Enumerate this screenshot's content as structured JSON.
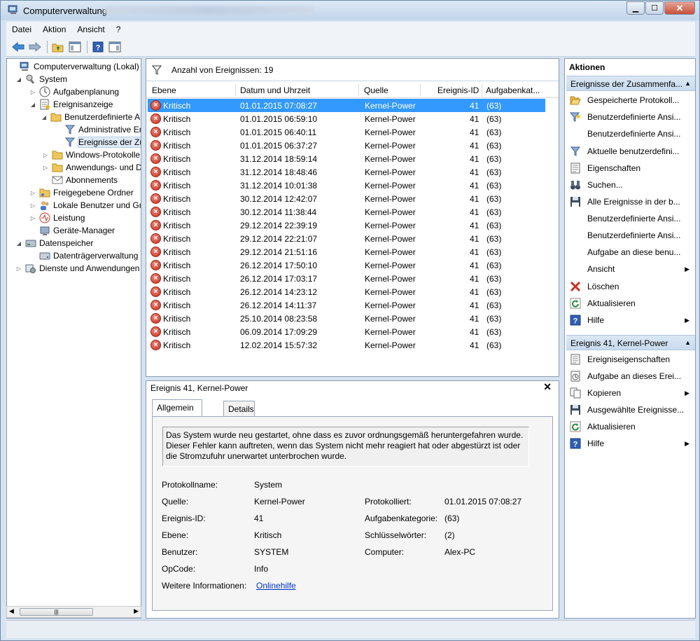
{
  "window": {
    "title": "Computerverwaltung",
    "buttons": {
      "minimize": "▁",
      "maximize": "☐",
      "close": "✕"
    }
  },
  "menu": {
    "items": [
      "Datei",
      "Aktion",
      "Ansicht",
      "?"
    ]
  },
  "toolbar": {
    "icons": [
      "back-arrow-icon",
      "forward-arrow-icon",
      "folder-up-icon",
      "show-hide-tree-icon",
      "help-icon",
      "show-hide-action-icon"
    ]
  },
  "tree": {
    "items": [
      {
        "label": "Computerverwaltung (Lokal)",
        "icon": "computer-management-icon",
        "expander": ""
      },
      {
        "label": "System",
        "icon": "system-tools-icon",
        "expander": "◢"
      },
      {
        "label": "Aufgabenplanung",
        "icon": "clock-icon",
        "expander": "▷"
      },
      {
        "label": "Ereignisanzeige",
        "icon": "event-viewer-icon",
        "expander": "◢"
      },
      {
        "label": "Benutzerdefinierte Ansichten",
        "icon": "folder-icon",
        "expander": "◢"
      },
      {
        "label": "Administrative Ereignisse",
        "icon": "filter-icon",
        "expander": ""
      },
      {
        "label": "Ereignisse der Zusammenfassungsseite",
        "icon": "filter-icon",
        "expander": ""
      },
      {
        "label": "Windows-Protokolle",
        "icon": "folder-icon",
        "expander": "▷"
      },
      {
        "label": "Anwendungs- und Dienstprotokolle",
        "icon": "folder-icon",
        "expander": "▷"
      },
      {
        "label": "Abonnements",
        "icon": "subscriptions-icon",
        "expander": ""
      },
      {
        "label": "Freigegebene Ordner",
        "icon": "shared-folder-icon",
        "expander": "▷"
      },
      {
        "label": "Lokale Benutzer und Gruppen",
        "icon": "users-icon",
        "expander": "▷"
      },
      {
        "label": "Leistung",
        "icon": "performance-icon",
        "expander": "▷"
      },
      {
        "label": "Geräte-Manager",
        "icon": "device-manager-icon",
        "expander": ""
      },
      {
        "label": "Datenspeicher",
        "icon": "storage-icon",
        "expander": "◢"
      },
      {
        "label": "Datenträgerverwaltung",
        "icon": "disk-icon",
        "expander": ""
      },
      {
        "label": "Dienste und Anwendungen",
        "icon": "services-icon",
        "expander": "▷"
      }
    ]
  },
  "events": {
    "filter_label": "Anzahl von Ereignissen: 19",
    "columns": [
      "Ebene",
      "Datum und Uhrzeit",
      "Quelle",
      "Ereignis-ID",
      "Aufgabenkat..."
    ],
    "rows": [
      {
        "level": "Kritisch",
        "date": "01.01.2015 07:08:27",
        "source": "Kernel-Power",
        "id": "41",
        "cat": "(63)"
      },
      {
        "level": "Kritisch",
        "date": "01.01.2015 06:59:10",
        "source": "Kernel-Power",
        "id": "41",
        "cat": "(63)"
      },
      {
        "level": "Kritisch",
        "date": "01.01.2015 06:40:11",
        "source": "Kernel-Power",
        "id": "41",
        "cat": "(63)"
      },
      {
        "level": "Kritisch",
        "date": "01.01.2015 06:37:27",
        "source": "Kernel-Power",
        "id": "41",
        "cat": "(63)"
      },
      {
        "level": "Kritisch",
        "date": "31.12.2014 18:59:14",
        "source": "Kernel-Power",
        "id": "41",
        "cat": "(63)"
      },
      {
        "level": "Kritisch",
        "date": "31.12.2014 18:48:46",
        "source": "Kernel-Power",
        "id": "41",
        "cat": "(63)"
      },
      {
        "level": "Kritisch",
        "date": "31.12.2014 10:01:38",
        "source": "Kernel-Power",
        "id": "41",
        "cat": "(63)"
      },
      {
        "level": "Kritisch",
        "date": "30.12.2014 12:42:07",
        "source": "Kernel-Power",
        "id": "41",
        "cat": "(63)"
      },
      {
        "level": "Kritisch",
        "date": "30.12.2014 11:38:44",
        "source": "Kernel-Power",
        "id": "41",
        "cat": "(63)"
      },
      {
        "level": "Kritisch",
        "date": "29.12.2014 22:39:19",
        "source": "Kernel-Power",
        "id": "41",
        "cat": "(63)"
      },
      {
        "level": "Kritisch",
        "date": "29.12.2014 22:21:07",
        "source": "Kernel-Power",
        "id": "41",
        "cat": "(63)"
      },
      {
        "level": "Kritisch",
        "date": "29.12.2014 21:51:16",
        "source": "Kernel-Power",
        "id": "41",
        "cat": "(63)"
      },
      {
        "level": "Kritisch",
        "date": "26.12.2014 17:50:10",
        "source": "Kernel-Power",
        "id": "41",
        "cat": "(63)"
      },
      {
        "level": "Kritisch",
        "date": "26.12.2014 17:03:17",
        "source": "Kernel-Power",
        "id": "41",
        "cat": "(63)"
      },
      {
        "level": "Kritisch",
        "date": "26.12.2014 14:23:12",
        "source": "Kernel-Power",
        "id": "41",
        "cat": "(63)"
      },
      {
        "level": "Kritisch",
        "date": "26.12.2014 14:11:37",
        "source": "Kernel-Power",
        "id": "41",
        "cat": "(63)"
      },
      {
        "level": "Kritisch",
        "date": "25.10.2014 08:23:58",
        "source": "Kernel-Power",
        "id": "41",
        "cat": "(63)"
      },
      {
        "level": "Kritisch",
        "date": "06.09.2014 17:09:29",
        "source": "Kernel-Power",
        "id": "41",
        "cat": "(63)"
      },
      {
        "level": "Kritisch",
        "date": "12.02.2014 15:57:32",
        "source": "Kernel-Power",
        "id": "41",
        "cat": "(63)"
      }
    ]
  },
  "detail": {
    "title": "Ereignis 41, Kernel-Power",
    "close": "✕",
    "tabs": [
      "Allgemein",
      "Details"
    ],
    "description": "Das System wurde neu gestartet, ohne dass es zuvor ordnungsgemäß heruntergefahren wurde. Dieser Fehler kann auftreten, wenn das System nicht mehr reagiert hat oder abgestürzt ist oder die Stromzufuhr unerwartet unterbrochen wurde.",
    "fields": {
      "protokollname_label": "Protokollname:",
      "protokollname": "System",
      "quelle_label": "Quelle:",
      "quelle": "Kernel-Power",
      "protokolliert_label": "Protokolliert:",
      "protokolliert": "01.01.2015 07:08:27",
      "ereignisid_label": "Ereignis-ID:",
      "ereignisid": "41",
      "aufgabenkategorie_label": "Aufgabenkategorie:",
      "aufgabenkategorie": "(63)",
      "ebene_label": "Ebene:",
      "ebene": "Kritisch",
      "schluessel_label": "Schlüsselwörter:",
      "schluessel": "(2)",
      "benutzer_label": "Benutzer:",
      "benutzer": "SYSTEM",
      "computer_label": "Computer:",
      "computer": "Alex-PC",
      "opcode_label": "OpCode:",
      "opcode": "Info",
      "weitere_label": "Weitere Informationen:",
      "weitere_link": "Onlinehilfe"
    }
  },
  "actions": {
    "title": "Aktionen",
    "section1": {
      "header": "Ereignisse der Zusammenfa...",
      "items": [
        {
          "label": "Gespeicherte Protokoll...",
          "icon": "open-folder-icon",
          "arrow": ""
        },
        {
          "label": "Benutzerdefinierte Ansi...",
          "icon": "filter-star-icon",
          "arrow": ""
        },
        {
          "label": "Benutzerdefinierte Ansi...",
          "icon": "",
          "arrow": ""
        },
        {
          "label": "Aktuelle benutzerdefini...",
          "icon": "filter-icon",
          "arrow": ""
        },
        {
          "label": "Eigenschaften",
          "icon": "properties-icon",
          "arrow": ""
        },
        {
          "label": "Suchen...",
          "icon": "binoculars-icon",
          "arrow": ""
        },
        {
          "label": "Alle Ereignisse in der b...",
          "icon": "save-icon",
          "arrow": ""
        },
        {
          "label": "Benutzerdefinierte Ansi...",
          "icon": "",
          "arrow": ""
        },
        {
          "label": "Benutzerdefinierte Ansi...",
          "icon": "",
          "arrow": ""
        },
        {
          "label": "Aufgabe an diese benu...",
          "icon": "",
          "arrow": ""
        },
        {
          "label": "Ansicht",
          "icon": "",
          "arrow": "▶"
        },
        {
          "label": "Löschen",
          "icon": "delete-icon",
          "arrow": ""
        },
        {
          "label": "Aktualisieren",
          "icon": "refresh-icon",
          "arrow": ""
        },
        {
          "label": "Hilfe",
          "icon": "help-icon",
          "arrow": "▶"
        }
      ]
    },
    "section2": {
      "header": "Ereignis 41, Kernel-Power",
      "items": [
        {
          "label": "Ereigniseigenschaften",
          "icon": "properties-icon",
          "arrow": ""
        },
        {
          "label": "Aufgabe an dieses Erei...",
          "icon": "task-icon",
          "arrow": ""
        },
        {
          "label": "Kopieren",
          "icon": "copy-icon",
          "arrow": "▶"
        },
        {
          "label": "Ausgewählte Ereignisse...",
          "icon": "save-icon",
          "arrow": ""
        },
        {
          "label": "Aktualisieren",
          "icon": "refresh-icon",
          "arrow": ""
        },
        {
          "label": "Hilfe",
          "icon": "help-icon",
          "arrow": "▶"
        }
      ]
    }
  },
  "colors": {
    "selection": "#3399ff",
    "accent": "#c9dbef",
    "error": "#c52d1f",
    "link": "#0033cc"
  }
}
